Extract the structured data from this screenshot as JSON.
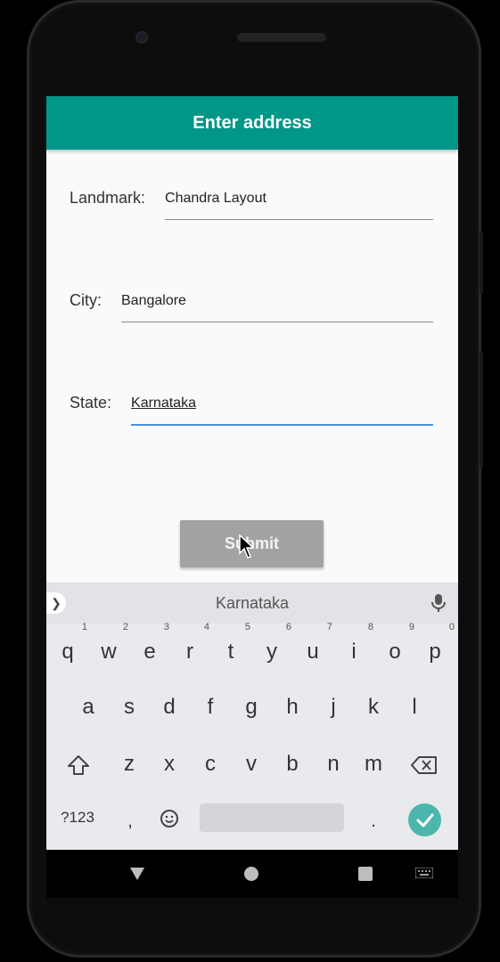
{
  "app": {
    "title": "Enter address"
  },
  "form": {
    "landmark_label": "Landmark:",
    "landmark_value": "Chandra Layout",
    "city_label": "City:",
    "city_value": "Bangalore",
    "state_label": "State:",
    "state_value": "Karnataka",
    "submit_label": "Submit"
  },
  "keyboard": {
    "suggestion": "Karnataka",
    "row1": [
      "q",
      "w",
      "e",
      "r",
      "t",
      "y",
      "u",
      "i",
      "o",
      "p"
    ],
    "row1_hints": [
      "1",
      "2",
      "3",
      "4",
      "5",
      "6",
      "7",
      "8",
      "9",
      "0"
    ],
    "row2": [
      "a",
      "s",
      "d",
      "f",
      "g",
      "h",
      "j",
      "k",
      "l"
    ],
    "row3": [
      "z",
      "x",
      "c",
      "v",
      "b",
      "n",
      "m"
    ],
    "symbols_label": "?123",
    "comma": ",",
    "period": ".",
    "icons": [
      "chevron-right-icon",
      "mic-icon",
      "shift-icon",
      "backspace-icon",
      "emoji-icon",
      "check-icon"
    ],
    "accent_color": "#4db6ac"
  },
  "colors": {
    "appbar": "#009688",
    "focus_underline": "#4a90d9",
    "submit_bg": "#a3a3a3"
  },
  "navigation": {
    "icons": [
      "back-icon",
      "home-icon",
      "recents-icon",
      "keyboard-switch-icon"
    ]
  }
}
